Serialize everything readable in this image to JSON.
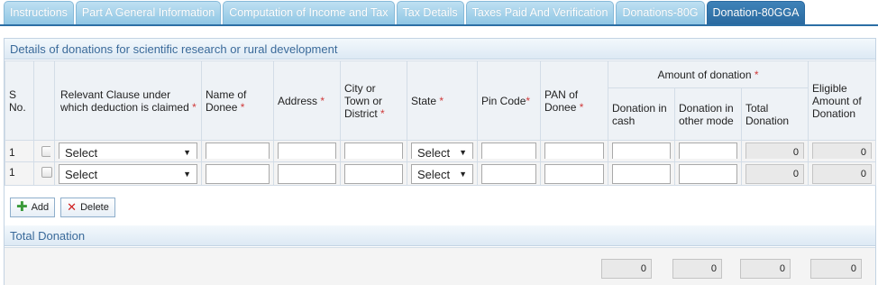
{
  "tabs": [
    {
      "label": "Instructions",
      "active": false
    },
    {
      "label": "Part A General Information",
      "active": false
    },
    {
      "label": "Computation of Income and Tax",
      "active": false
    },
    {
      "label": "Tax Details",
      "active": false
    },
    {
      "label": "Taxes Paid And Verification",
      "active": false
    },
    {
      "label": "Donations-80G",
      "active": false
    },
    {
      "label": "Donation-80GGA",
      "active": true
    }
  ],
  "section": {
    "title": "Details of donations for scientific research or rural development"
  },
  "table": {
    "headers": {
      "sno": "S No.",
      "clause": "Relevant Clause under which deduction is claimed",
      "donee_name": "Name of Donee",
      "address": "Address",
      "city": "City or Town or District",
      "state": "State",
      "pin": "Pin Code",
      "pan": "PAN of Donee",
      "amount_group": "Amount of donation",
      "cash": "Donation in cash",
      "other_mode": "Donation in other mode",
      "total": "Total Donation",
      "eligible": "Eligible Amount of Donation",
      "required_mark": "*"
    },
    "rows": [
      {
        "sno": "1",
        "clause": "Select",
        "state": "Select",
        "total": "0",
        "eligible": "0",
        "clipped": true
      },
      {
        "sno": "1",
        "clause": "Select",
        "state": "Select",
        "total": "0",
        "eligible": "0",
        "clipped": false
      }
    ]
  },
  "buttons": {
    "add": "Add",
    "delete": "Delete"
  },
  "total_section": {
    "title": "Total Donation",
    "values": [
      "0",
      "0",
      "0",
      "0"
    ]
  },
  "colors": {
    "active_tab": "#2a6aa0",
    "tab": "#9ccbe6",
    "required": "#d03a3a"
  }
}
